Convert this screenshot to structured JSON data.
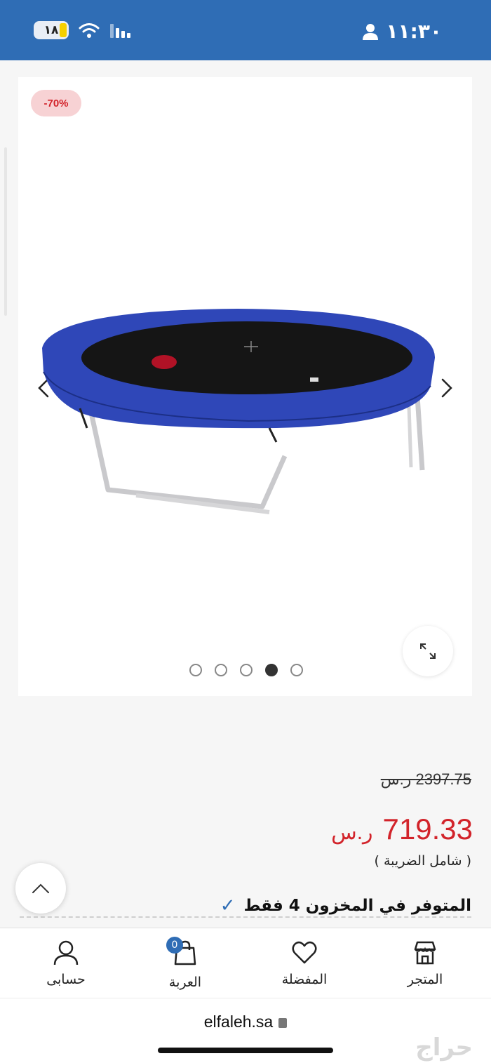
{
  "status_bar": {
    "time": "١١:٣٠",
    "battery": "١٨"
  },
  "product": {
    "discount_badge": "-70%",
    "old_price": "2397.75 ر.س",
    "new_price_value": "719.33",
    "currency": "ر.س",
    "tax_note": "( شامل الضريبة )",
    "stock_text": "المتوفر في المخزون 4 فقط",
    "gallery": {
      "total_images": 5,
      "active_index": 3
    }
  },
  "bottom_nav": {
    "items": [
      {
        "label": "المتجر",
        "icon": "store-icon"
      },
      {
        "label": "المفضلة",
        "icon": "heart-icon"
      },
      {
        "label": "العربة",
        "icon": "shopping-bag-icon",
        "badge": "0"
      },
      {
        "label": "حسابى",
        "icon": "user-icon"
      }
    ]
  },
  "browser": {
    "url": "elfaleh.sa"
  },
  "watermark": "حراج",
  "colors": {
    "brand_blue": "#2f6db5",
    "sale_red": "#d2232a",
    "badge_bg": "#f7d2d4"
  }
}
